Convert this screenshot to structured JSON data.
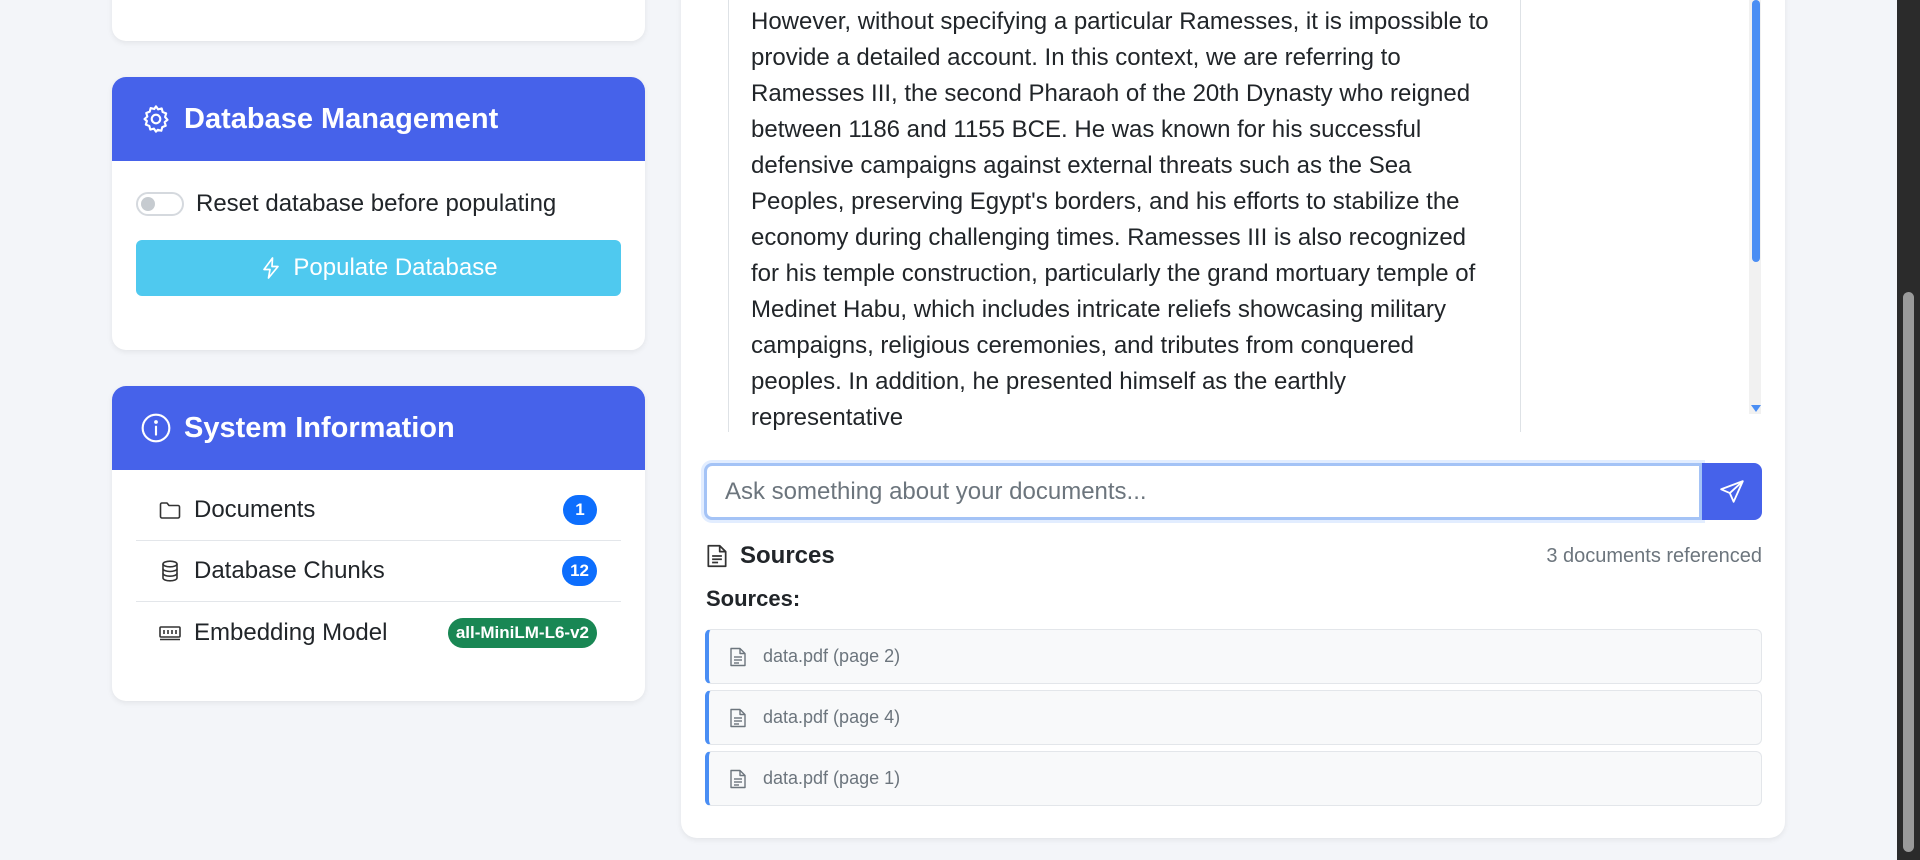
{
  "database_management": {
    "title": "Database Management",
    "reset_toggle_label": "Reset database before populating",
    "reset_enabled": false,
    "populate_button": "Populate Database"
  },
  "system_information": {
    "title": "System Information",
    "rows": [
      {
        "label": "Documents",
        "value": "1",
        "icon": "folder-icon"
      },
      {
        "label": "Database Chunks",
        "value": "12",
        "icon": "database-icon"
      },
      {
        "label": "Embedding Model",
        "value": "all-MiniLM-L6-v2",
        "icon": "memory-icon"
      }
    ]
  },
  "chat": {
    "message_text": "to the commonality of this name among the Egyptian royalty. However, without specifying a particular Ramesses, it is impossible to provide a detailed account. In this context, we are referring to Ramesses III, the second Pharaoh of the 20th Dynasty who reigned between 1186 and 1155 BCE. He was known for his successful defensive campaigns against external threats such as the Sea Peoples, preserving Egypt's borders, and his efforts to stabilize the economy during challenging times. Ramesses III is also recognized for his temple construction, particularly the grand mortuary temple of Medinet Habu, which includes intricate reliefs showcasing military campaigns, religious ceremonies, and tributes from conquered peoples. In addition, he presented himself as the earthly representative",
    "input_placeholder": "Ask something about your documents...",
    "input_value": ""
  },
  "sources": {
    "title": "Sources",
    "count_text": "3 documents referenced",
    "label": "Sources:",
    "items": [
      {
        "text": "data.pdf (page 2)"
      },
      {
        "text": "data.pdf (page 4)"
      },
      {
        "text": "data.pdf (page 1)"
      }
    ]
  },
  "colors": {
    "header_blue": "#4662ea",
    "populate_cyan": "#4fc9ef",
    "badge_blue": "#0d6efd",
    "badge_green": "#198754",
    "source_accent": "#4a8ef4"
  }
}
